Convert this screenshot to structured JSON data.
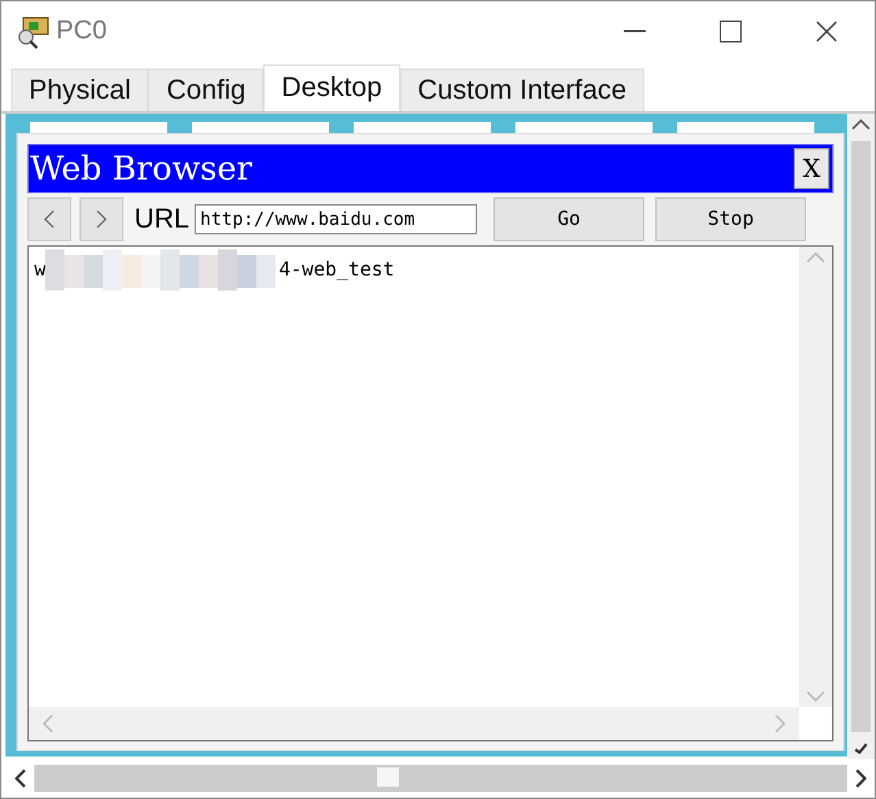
{
  "window": {
    "title": "PC0"
  },
  "tabs": [
    {
      "label": "Physical",
      "selected": false
    },
    {
      "label": "Config",
      "selected": false
    },
    {
      "label": "Desktop",
      "selected": true
    },
    {
      "label": "Custom Interface",
      "selected": false
    }
  ],
  "browser": {
    "title": "Web Browser",
    "close": "X",
    "url_label": "URL",
    "url": "http://www.baidu.com",
    "buttons": [
      "Go",
      "Stop"
    ],
    "content": [
      {
        "kind": "text",
        "text": "w"
      },
      {
        "kind": "redacted"
      },
      {
        "kind": "text",
        "text": "4-web_test"
      }
    ]
  }
}
